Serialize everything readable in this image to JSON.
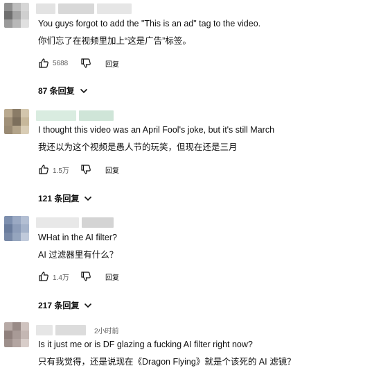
{
  "comments": [
    {
      "author_blurred": true,
      "timestamp": "",
      "text_en": "You guys forgot to add the \"This is an ad\" tag to the video.",
      "text_zh": "你们忘了在视频里加上“这是广告”标签。",
      "likes": "5688",
      "reply_label": "回复",
      "replies_label": "87 条回复",
      "avatar_colors": [
        "#8f8f8f",
        "#bdbdbd",
        "#d6d6d6",
        "#6f6f6f",
        "#a3a3a3",
        "#cfcfcf",
        "#9a9a9a",
        "#b8b8b8",
        "#e0e0e0"
      ],
      "author_colors": [
        "#e3e3e3",
        "#d8d8d8",
        "#e6e6e6"
      ]
    },
    {
      "author_blurred": true,
      "timestamp": "",
      "text_en": "I thought this video was an April Fool's joke, but it's still March",
      "text_zh": "我还以为这个视频是愚人节的玩笑，但现在还是三月",
      "likes": "1.5万",
      "reply_label": "回复",
      "replies_label": "121 条回复",
      "avatar_colors": [
        "#b9a98f",
        "#8a7c67",
        "#d3c6ad",
        "#a09078",
        "#7c6f5c",
        "#c7b89b",
        "#998a73",
        "#b3a48a",
        "#d9cdb5"
      ],
      "author_colors": [
        "#d9ece0",
        "#cfe5d8"
      ]
    },
    {
      "author_blurred": true,
      "timestamp": "",
      "text_en": "WHat in the AI filter?",
      "text_zh": "AI 过滤器里有什么？",
      "likes": "1.4万",
      "reply_label": "回复",
      "replies_label": "217 条回复",
      "avatar_colors": [
        "#7d8fae",
        "#9aa9c3",
        "#b3bfd3",
        "#6a7c9c",
        "#8c9cb8",
        "#a5b3ca",
        "#7788a6",
        "#95a5be",
        "#c0cadb"
      ],
      "author_colors": [
        "#e8e8e8",
        "#d4d4d4"
      ]
    },
    {
      "author_blurred": true,
      "timestamp": "2小时前",
      "text_en": "Is it just me or is DF glazing a fucking AI filter right now?",
      "text_zh": "只有我觉得，还是说现在《Dragon Flying》就是个该死的 AI 滤镜？",
      "likes": "",
      "reply_label": "",
      "replies_label": "",
      "avatar_colors": [
        "#b7aaa6",
        "#998b87",
        "#cfc3bf",
        "#8f807c",
        "#a89a96",
        "#c4b7b3",
        "#9d8f8b",
        "#b3a5a1",
        "#d8cdc9"
      ],
      "author_colors": [
        "#e6e6e6",
        "#dcdcdc"
      ]
    }
  ]
}
